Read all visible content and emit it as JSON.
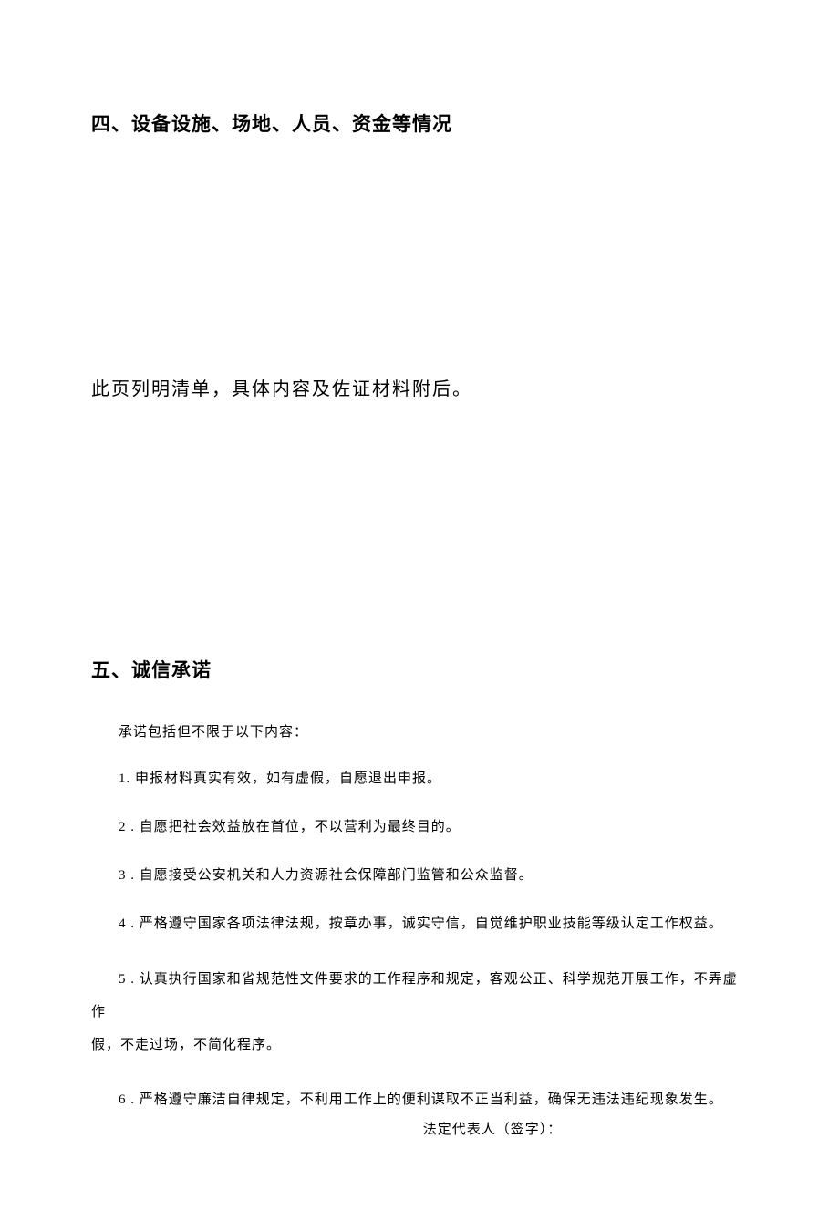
{
  "section4": {
    "heading": "四、设备设施、场地、人员、资金等情况",
    "note": "此页列明清单，具体内容及佐证材料附后。"
  },
  "section5": {
    "heading": "五、诚信承诺",
    "intro": "承诺包括但不限于以下内容：",
    "items": [
      "1. 申报材料真实有效，如有虚假，自愿退出申报。",
      "2  . 自愿把社会效益放在首位，不以营利为最终目的。",
      "3  . 自愿接受公安机关和人力资源社会保障部门监管和公众监督。",
      "4  . 严格遵守国家各项法律法规，按章办事，诚实守信，自觉维护职业技能等级认定工作权益。"
    ],
    "item5_first": "5  . 认真执行国家和省规范性文件要求的工作程序和规定，客观公正、科学规范开展工作，不弄虚作",
    "item5_rest": "假，不走过场，不简化程序。",
    "item6": "6  . 严格遵守廉洁自律规定，不利用工作上的便利谋取不正当利益，确保无违法违纪现象发生。",
    "signature": "法定代表人（签字）："
  }
}
